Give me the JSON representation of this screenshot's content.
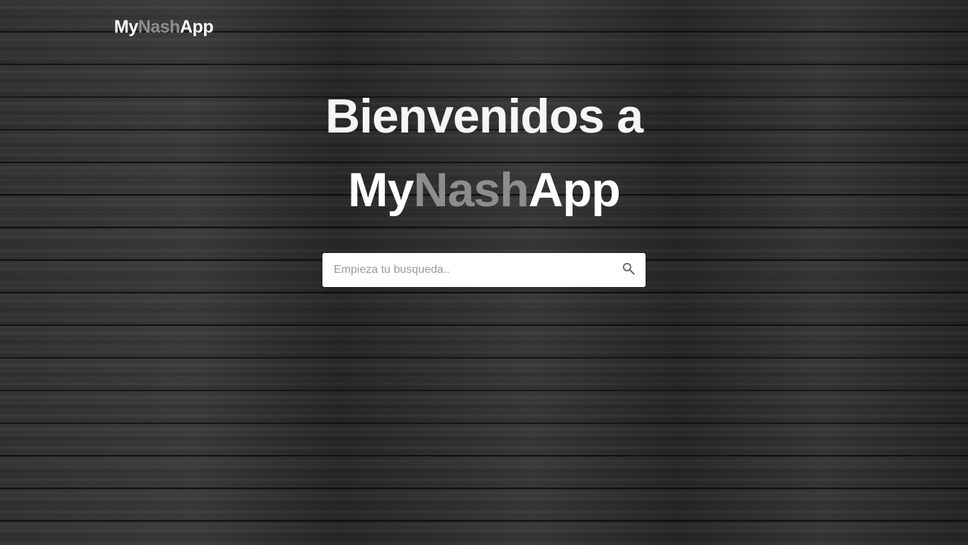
{
  "brand": {
    "part1": "My",
    "part2": "Nash",
    "part3": "App"
  },
  "hero": {
    "line1": "Bienvenidos a",
    "title_part1": "My",
    "title_part2": "Nash",
    "title_part3": "App"
  },
  "search": {
    "placeholder": "Empieza tu busqueda..",
    "value": "",
    "icon": "search-icon"
  },
  "colors": {
    "text_primary": "#ffffff",
    "text_accent": "#8d8d8d",
    "background": "#262626"
  }
}
